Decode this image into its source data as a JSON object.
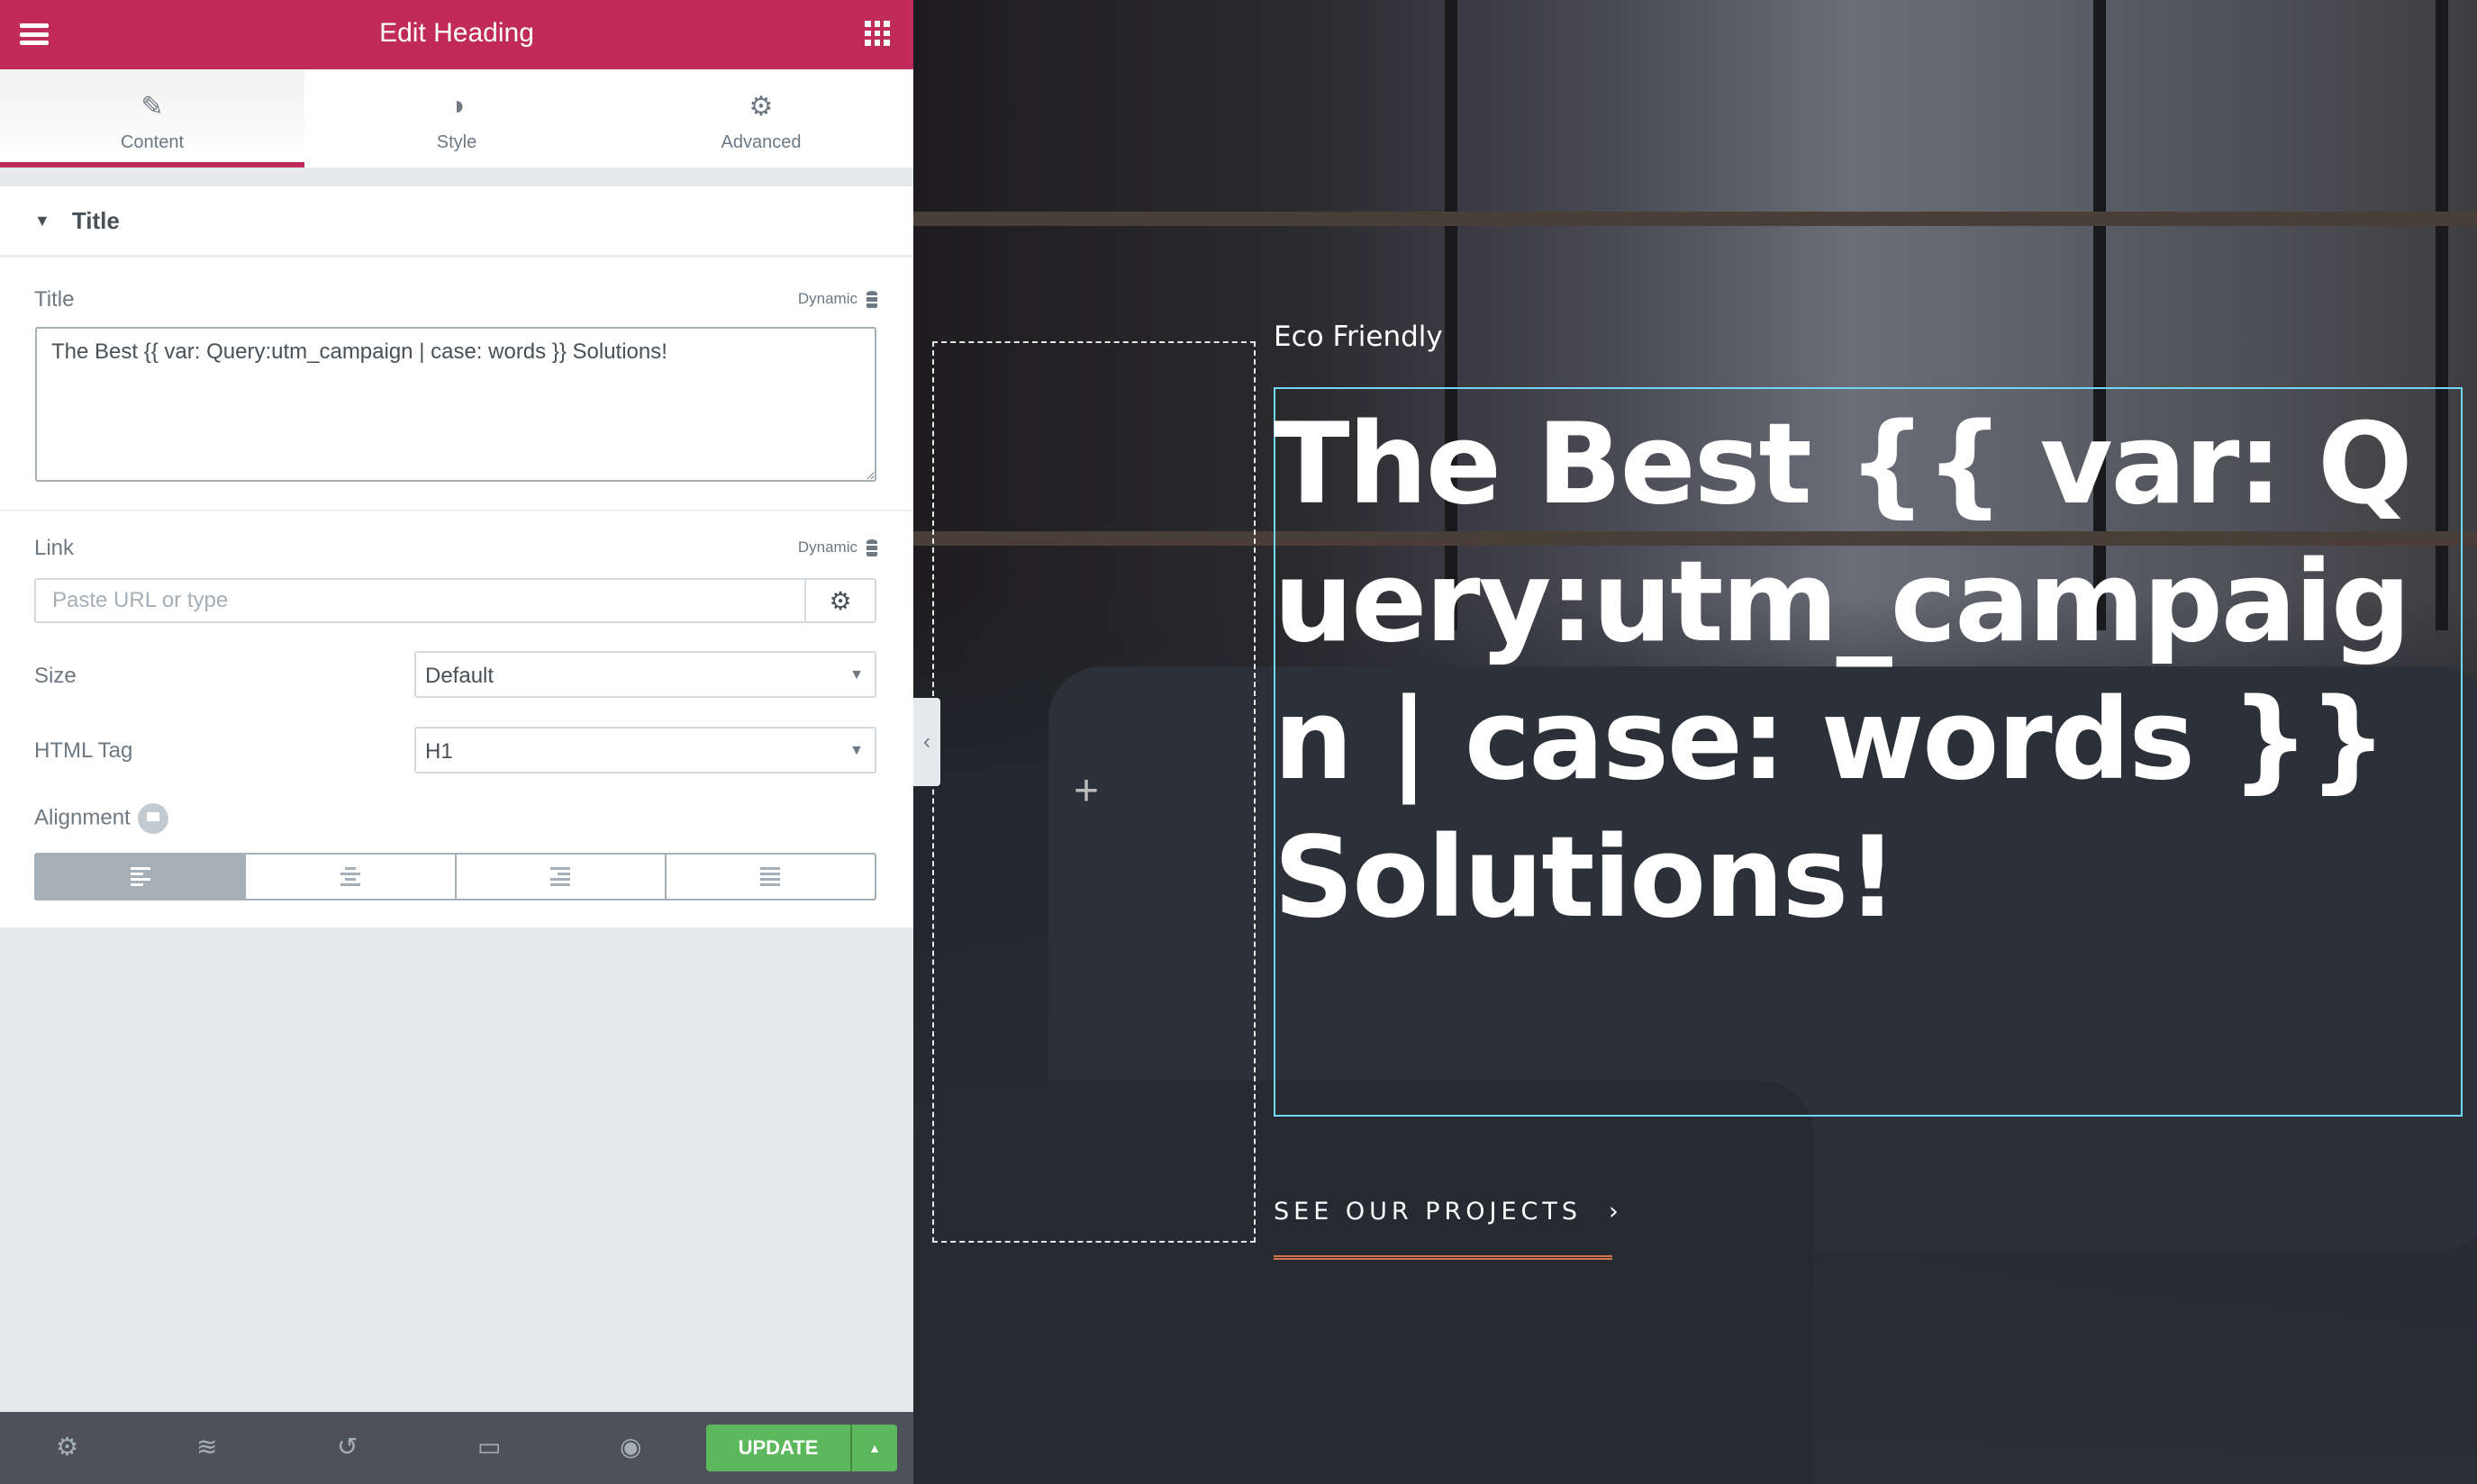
{
  "panel": {
    "header": {
      "title": "Edit Heading",
      "menu_icon": "hamburger-icon",
      "apps_icon": "grid-icon"
    },
    "tabs": [
      {
        "label": "Content",
        "icon": "pencil-icon",
        "active": true
      },
      {
        "label": "Style",
        "icon": "contrast-icon"
      },
      {
        "label": "Advanced",
        "icon": "gear-icon"
      }
    ],
    "section": {
      "title": "Title",
      "expanded": true
    },
    "title_field": {
      "label": "Title",
      "dynamic": "Dynamic",
      "value": "The Best {{ var: Query:utm_campaign | case: words }} Solutions!"
    },
    "link_field": {
      "label": "Link",
      "dynamic": "Dynamic",
      "placeholder": "Paste URL or type",
      "value": ""
    },
    "size_field": {
      "label": "Size",
      "value": "Default"
    },
    "tag_field": {
      "label": "HTML Tag",
      "value": "H1"
    },
    "alignment": {
      "label": "Alignment",
      "options": [
        "left",
        "center",
        "right",
        "justify"
      ],
      "selected": "left"
    },
    "footer": {
      "update_label": "UPDATE",
      "accent": "#5cb85c"
    },
    "accent": "#c02b5a"
  },
  "canvas": {
    "eyebrow": "Eco Friendly",
    "heading": "The Best {{ var: Query:utm_campaign | case: words }} Solutions!",
    "cta": "SEE OUR PROJECTS",
    "cta_underline_color": "#d5744a"
  }
}
